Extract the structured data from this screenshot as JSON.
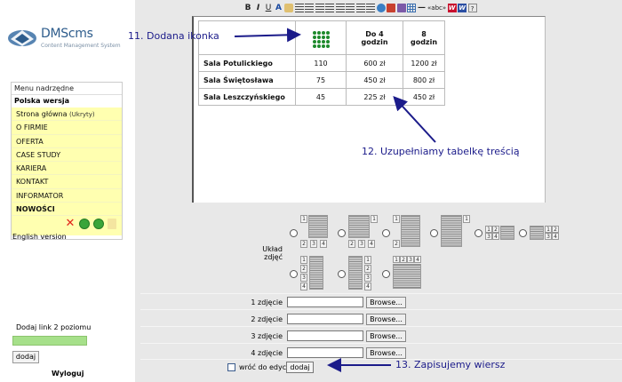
{
  "logo": {
    "name": "DMScms",
    "subtitle": "Content Management System"
  },
  "menu": {
    "header": "Menu nadrzędne",
    "language": "Polska wersja",
    "items": [
      {
        "label": "Strona główna",
        "sub": "(Ukryty)"
      },
      {
        "label": "O FIRMIE"
      },
      {
        "label": "OFERTA"
      },
      {
        "label": "CASE STUDY"
      },
      {
        "label": "KARIERA"
      },
      {
        "label": "KONTAKT"
      },
      {
        "label": "INFORMATOR"
      },
      {
        "label": "NOWOŚCI"
      }
    ],
    "other_language": "English version"
  },
  "add_level": {
    "label": "Dodaj link 2 poziomu",
    "button": "dodaj"
  },
  "logout": "Wyloguj",
  "toolbar": {
    "bold": "B",
    "italic": "I",
    "underline": "U",
    "font_color": "A",
    "abc": "«abc»",
    "word_a": "W",
    "word_b": "W",
    "help": "?"
  },
  "table": {
    "headers": [
      "",
      "Do 4 godzin",
      "8 godzin"
    ],
    "rows": [
      {
        "hall": "Sala Potulickiego",
        "people": "110",
        "price4": "600 zł",
        "price8": "1200 zł"
      },
      {
        "hall": "Sala Świętosława",
        "people": "75",
        "price4": "450 zł",
        "price8": "800 zł"
      },
      {
        "hall": "Sala Leszczyńskiego",
        "people": "45",
        "price4": "225 zł",
        "price8": "450 zł"
      }
    ]
  },
  "layout_label": "Układ zdjęć",
  "thumb_numbers": [
    "1",
    "2",
    "3",
    "4"
  ],
  "photos": [
    {
      "label": "1 zdjęcie",
      "browse": "Browse..."
    },
    {
      "label": "2 zdjęcie",
      "browse": "Browse..."
    },
    {
      "label": "3 zdjęcie",
      "browse": "Browse..."
    },
    {
      "label": "4 zdjęcie",
      "browse": "Browse..."
    }
  ],
  "return_label": "wróć do edycji",
  "save_button": "dodaj",
  "annotations": {
    "a11": "11. Dodana ikonka",
    "a12": "12. Uzupełniamy tabelkę treścią",
    "a13": "13. Zapisujemy wiersz"
  },
  "colors": {
    "menu_highlight": "#ffffb0",
    "accent_green": "#a6e08a",
    "annotation": "#1b1b8a",
    "icon_green": "#1e8a2c"
  }
}
